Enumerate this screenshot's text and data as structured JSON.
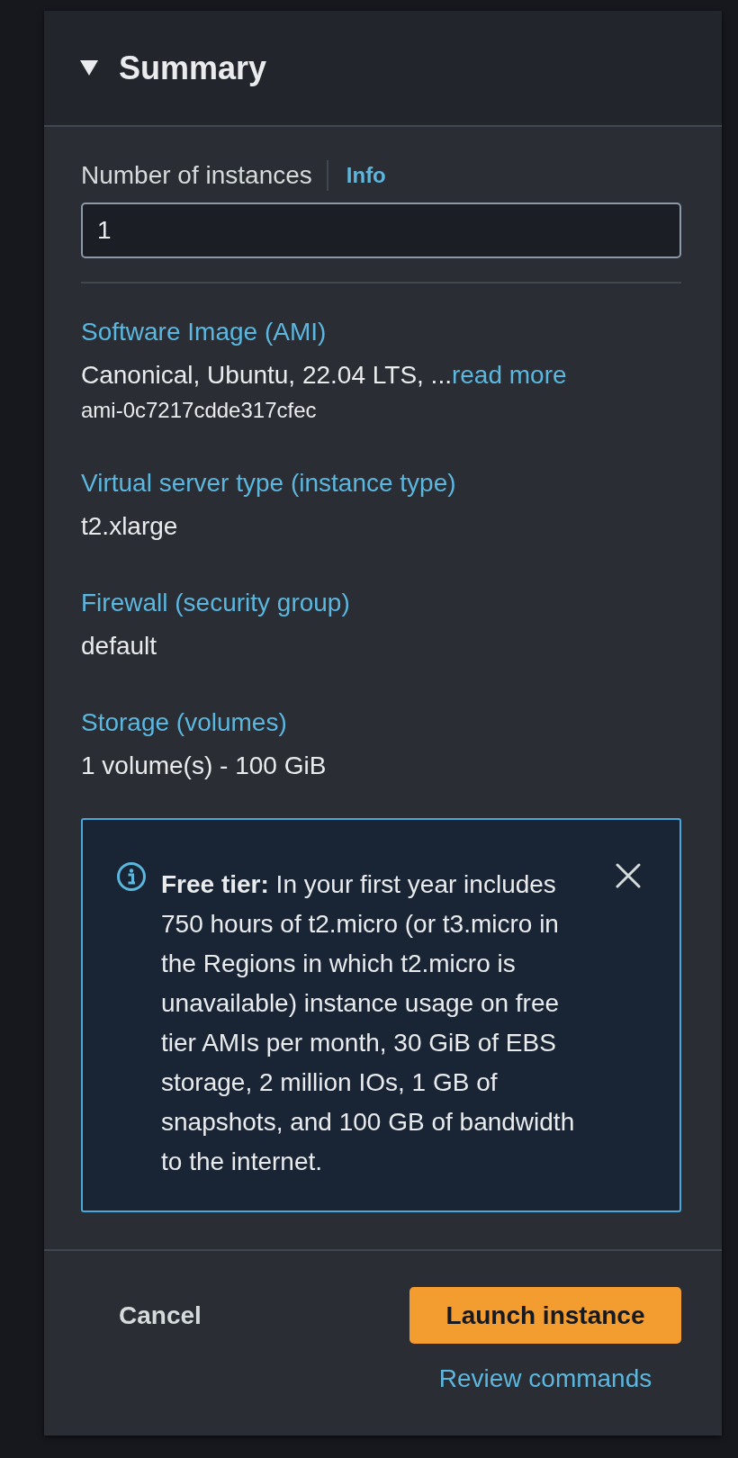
{
  "summary": {
    "title": "Summary",
    "expanded": true
  },
  "instances": {
    "label": "Number of instances",
    "info": "Info",
    "value": "1"
  },
  "details": [
    {
      "label": "Software Image (AMI)",
      "value": "Canonical, Ubuntu, 22.04 LTS, ...",
      "link": "read more",
      "sub": "ami-0c7217cdde317cfec"
    },
    {
      "label": "Virtual server type (instance type)",
      "value": "t2.xlarge"
    },
    {
      "label": "Firewall (security group)",
      "value": "default"
    },
    {
      "label": "Storage (volumes)",
      "value": "1 volume(s) - 100 GiB"
    }
  ],
  "alert": {
    "kind": "info",
    "text": "**Free tier:** In your first year includes 750 hours of t2.micro (or t3.micro in the Regions in which t2.micro is unavailable) instance usage on free tier AMIs per month, 30 GiB of EBS storage, 2 million IOs, 1 GB of snapshots, and 100 GB of bandwidth to the internet.",
    "dismissible": true
  },
  "footer": {
    "cancel": "Cancel",
    "primary": "Launch instance",
    "secondary": "Review commands"
  }
}
